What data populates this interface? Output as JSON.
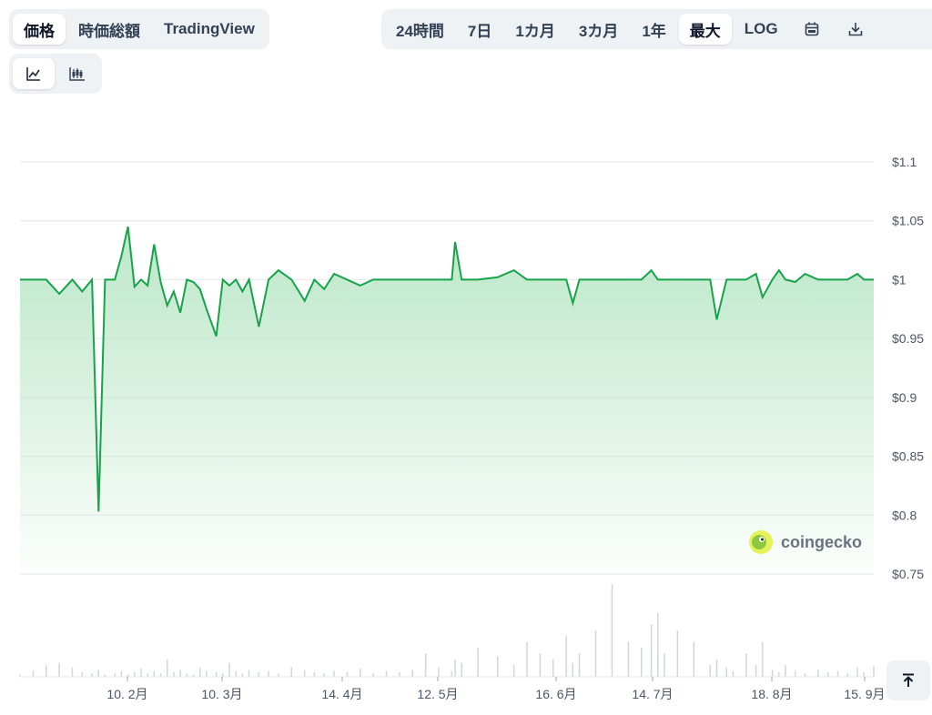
{
  "tabs": [
    {
      "label": "価格",
      "active": true
    },
    {
      "label": "時価総額",
      "active": false
    },
    {
      "label": "TradingView",
      "active": false
    }
  ],
  "ranges": [
    {
      "label": "24時間",
      "active": false
    },
    {
      "label": "7日",
      "active": false
    },
    {
      "label": "1カ月",
      "active": false
    },
    {
      "label": "3カ月",
      "active": false
    },
    {
      "label": "1年",
      "active": false
    },
    {
      "label": "最大",
      "active": true
    },
    {
      "label": "LOG",
      "active": false
    }
  ],
  "icons": {
    "calendar": "calendar-icon",
    "download": "download-icon",
    "line_chart": "line-chart-icon",
    "candlestick": "candlestick-icon",
    "scroll_top": "arrow-up-to-line-icon",
    "watermark_logo": "gecko-logo-icon"
  },
  "watermark": "coingecko",
  "colors": {
    "line": "#16a34a",
    "area_top": "#bbe7c8",
    "grid": "#e5e7eb",
    "volume": "#d1d5db"
  },
  "chart_data": {
    "type": "line",
    "ylabel_prefix": "$",
    "yticks": [
      "$1.1",
      "$1.05",
      "$1",
      "$0.95",
      "$0.9",
      "$0.85",
      "$0.8",
      "$0.75"
    ],
    "ylim": [
      0.75,
      1.1
    ],
    "xticks": [
      "10. 2月",
      "10. 3月",
      "14. 4月",
      "12. 5月",
      "16. 6月",
      "14. 7月",
      "18. 8月",
      "15. 9月"
    ],
    "x": [
      "2024-01-01",
      "2024-01-05",
      "2024-01-09",
      "2024-01-13",
      "2024-01-17",
      "2024-01-20",
      "2024-01-23",
      "2024-01-25",
      "2024-01-27",
      "2024-01-30",
      "2024-02-01",
      "2024-02-03",
      "2024-02-05",
      "2024-02-07",
      "2024-02-09",
      "2024-02-11",
      "2024-02-13",
      "2024-02-15",
      "2024-02-17",
      "2024-02-19",
      "2024-02-21",
      "2024-02-23",
      "2024-02-25",
      "2024-02-27",
      "2024-03-01",
      "2024-03-03",
      "2024-03-05",
      "2024-03-07",
      "2024-03-09",
      "2024-03-11",
      "2024-03-14",
      "2024-03-17",
      "2024-03-20",
      "2024-03-24",
      "2024-03-28",
      "2024-03-31",
      "2024-04-03",
      "2024-04-06",
      "2024-04-10",
      "2024-04-14",
      "2024-04-18",
      "2024-04-22",
      "2024-04-26",
      "2024-04-30",
      "2024-05-04",
      "2024-05-08",
      "2024-05-12",
      "2024-05-13",
      "2024-05-15",
      "2024-05-20",
      "2024-05-26",
      "2024-05-31",
      "2024-06-04",
      "2024-06-08",
      "2024-06-12",
      "2024-06-16",
      "2024-06-18",
      "2024-06-20",
      "2024-06-25",
      "2024-06-30",
      "2024-07-05",
      "2024-07-09",
      "2024-07-12",
      "2024-07-14",
      "2024-07-16",
      "2024-07-20",
      "2024-07-25",
      "2024-07-30",
      "2024-08-01",
      "2024-08-04",
      "2024-08-06",
      "2024-08-10",
      "2024-08-13",
      "2024-08-15",
      "2024-08-18",
      "2024-08-20",
      "2024-08-22",
      "2024-08-25",
      "2024-08-28",
      "2024-09-01",
      "2024-09-04",
      "2024-09-07",
      "2024-09-10",
      "2024-09-13",
      "2024-09-15",
      "2024-09-18"
    ],
    "values": [
      1.0,
      1.0,
      1.0,
      0.988,
      1.0,
      0.99,
      1.0,
      0.803,
      1.0,
      1.0,
      1.02,
      1.045,
      0.994,
      1.0,
      0.995,
      1.03,
      0.998,
      0.978,
      0.99,
      0.972,
      1.0,
      0.998,
      0.992,
      0.975,
      0.952,
      1.0,
      0.995,
      1.0,
      0.99,
      1.0,
      0.96,
      1.0,
      1.008,
      1.0,
      0.982,
      1.0,
      0.992,
      1.005,
      1.0,
      0.995,
      1.0,
      1.0,
      1.0,
      1.0,
      1.0,
      1.0,
      1.0,
      1.032,
      1.0,
      1.0,
      1.002,
      1.008,
      1.0,
      1.0,
      1.0,
      1.0,
      0.98,
      1.0,
      1.0,
      1.0,
      1.0,
      1.0,
      1.008,
      1.0,
      1.0,
      1.0,
      1.0,
      1.0,
      0.966,
      1.0,
      1.0,
      1.0,
      1.005,
      0.985,
      1.0,
      1.008,
      1.0,
      0.998,
      1.005,
      1.0,
      1.0,
      1.0,
      1.0,
      1.005,
      1.0,
      1.0
    ],
    "volume": [
      0.02,
      0.05,
      0.1,
      0.12,
      0.08,
      0.04,
      0.03,
      0.06,
      0.02,
      0.03,
      0.05,
      0.02,
      0.04,
      0.07,
      0.03,
      0.05,
      0.03,
      0.15,
      0.04,
      0.06,
      0.03,
      0.02,
      0.08,
      0.05,
      0.04,
      0.03,
      0.12,
      0.05,
      0.03,
      0.06,
      0.04,
      0.05,
      0.03,
      0.08,
      0.06,
      0.04,
      0.03,
      0.05,
      0.04,
      0.07,
      0.03,
      0.05,
      0.04,
      0.06,
      0.2,
      0.08,
      0.05,
      0.15,
      0.12,
      0.25,
      0.18,
      0.1,
      0.3,
      0.2,
      0.15,
      0.35,
      0.12,
      0.2,
      0.4,
      0.8,
      0.3,
      0.25,
      0.45,
      0.55,
      0.2,
      0.4,
      0.3,
      0.1,
      0.15,
      0.08,
      0.05,
      0.2,
      0.1,
      0.3,
      0.06,
      0.04,
      0.1,
      0.05,
      0.03,
      0.06,
      0.04,
      0.05,
      0.03,
      0.08,
      0.04,
      0.09
    ]
  }
}
